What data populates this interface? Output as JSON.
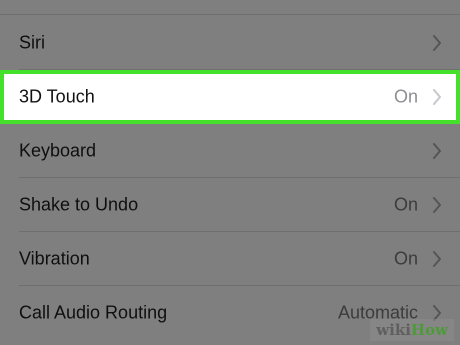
{
  "settings": {
    "rows": [
      {
        "label": "Siri",
        "value": ""
      },
      {
        "label": "3D Touch",
        "value": "On"
      },
      {
        "label": "Keyboard",
        "value": ""
      },
      {
        "label": "Shake to Undo",
        "value": "On"
      },
      {
        "label": "Vibration",
        "value": "On"
      },
      {
        "label": "Call Audio Routing",
        "value": "Automatic"
      }
    ]
  },
  "watermark": {
    "part1": "wiki",
    "part2": "How"
  },
  "colors": {
    "highlight_border": "#45e02c",
    "dim_background": "#7f7f7f",
    "highlight_background": "#ffffff"
  },
  "icons": {
    "chevron": "chevron-right-icon"
  }
}
